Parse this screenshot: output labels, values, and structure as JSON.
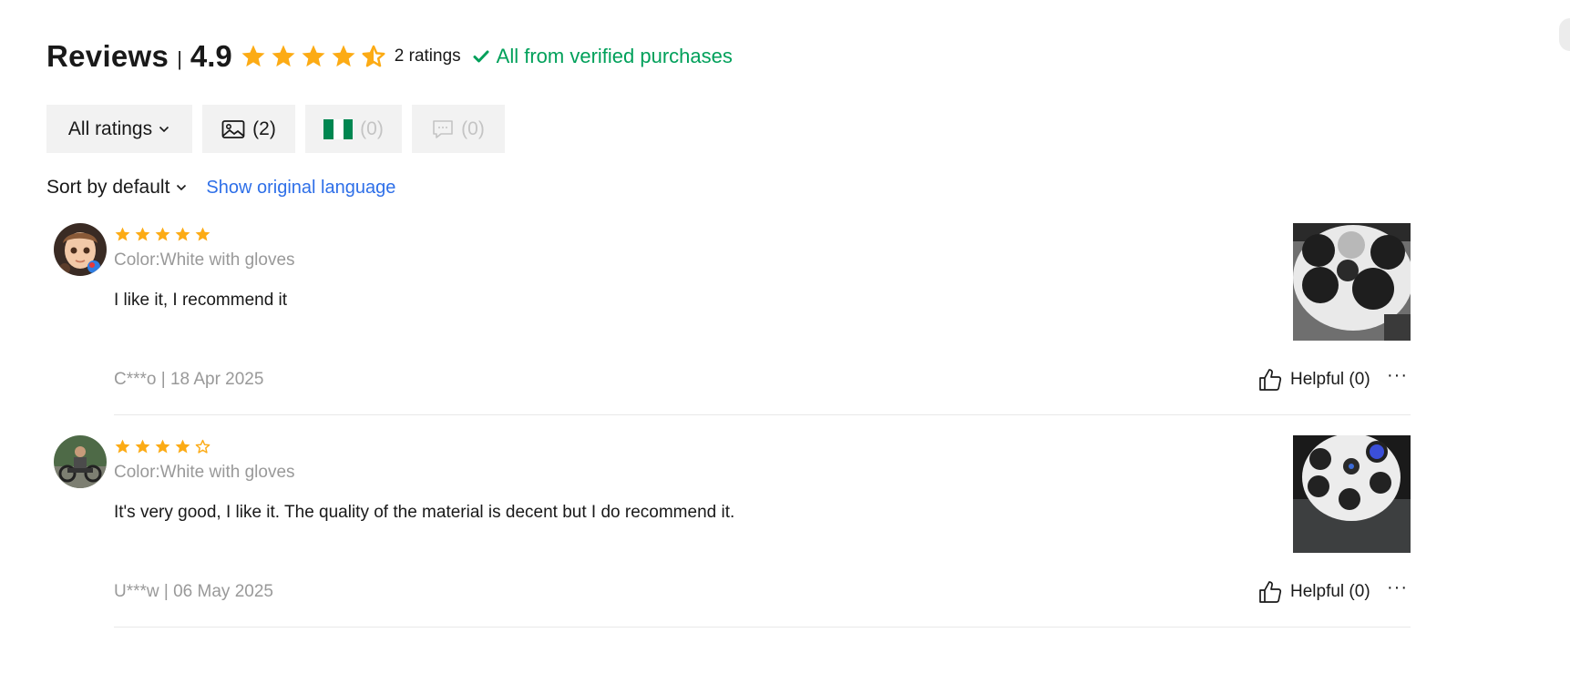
{
  "header": {
    "title": "Reviews",
    "separator": "|",
    "score": "4.9",
    "rating_count": "2 ratings",
    "verified": "All from verified purchases"
  },
  "filters": {
    "all_ratings": "All ratings",
    "photos_count": "(2)",
    "country_count": "(0)",
    "comments_count": "(0)"
  },
  "sort": {
    "label": "Sort by default",
    "show_original": "Show original language"
  },
  "reviews": [
    {
      "rating": 5,
      "color": "Color:White with gloves",
      "text": "I like it, I recommend it",
      "meta": "C***o | 18 Apr 2025",
      "helpful": "Helpful (0)",
      "more": "···"
    },
    {
      "rating": 4,
      "color": "Color:White with gloves",
      "text": "It's very good, I like it. The quality of the material is decent but I do recommend it.",
      "meta": "U***w | 06 May 2025",
      "helpful": "Helpful (0)",
      "more": "···"
    }
  ],
  "colors": {
    "star": "#fcab15",
    "verified": "#00a05a",
    "link": "#2e6fe8",
    "muted": "#999999",
    "chip_bg": "#f2f2f2"
  }
}
